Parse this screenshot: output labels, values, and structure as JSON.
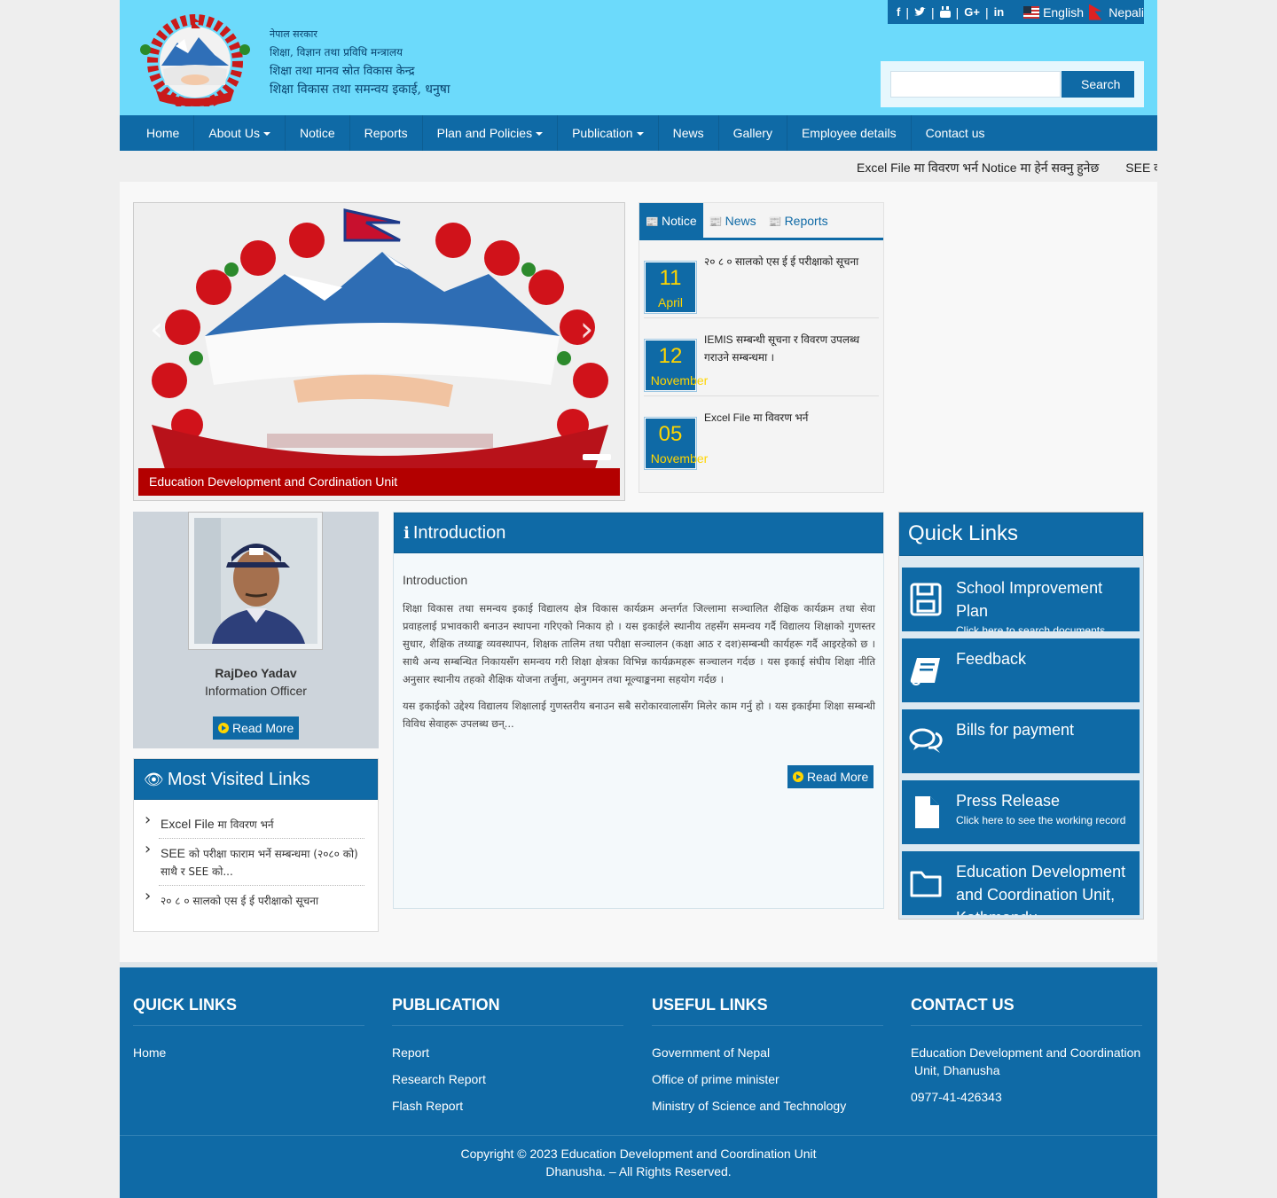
{
  "header": {
    "office_lines": [
      "नेपाल सरकार",
      "शिक्षा, विज्ञान तथा प्रविधि मन्त्रालय",
      "शिक्षा तथा मानव स्रोत विकास केन्द्र",
      "शिक्षा विकास तथा समन्वय इकाई, धनुषा"
    ],
    "social_icons": [
      "facebook-icon",
      "twitter-icon",
      "youtube-icon",
      "google-plus-icon",
      "linkedin-icon"
    ],
    "lang_english": "English",
    "lang_nepali": "Nepali",
    "search": {
      "placeholder": "",
      "button": "Search"
    }
  },
  "nav": [
    {
      "label": "Home",
      "dropdown": false
    },
    {
      "label": "About Us",
      "dropdown": true
    },
    {
      "label": "Notice",
      "dropdown": false
    },
    {
      "label": "Reports",
      "dropdown": false
    },
    {
      "label": "Plan and Policies",
      "dropdown": true
    },
    {
      "label": "Publication",
      "dropdown": true
    },
    {
      "label": "News",
      "dropdown": false
    },
    {
      "label": "Gallery",
      "dropdown": false
    },
    {
      "label": "Employee details",
      "dropdown": false
    },
    {
      "label": "Contact us",
      "dropdown": false
    }
  ],
  "ticker": [
    "Excel File मा विवरण भर्न Notice मा हेर्न सक्नु हुनेछ",
    "SEE को"
  ],
  "slider": {
    "caption": "Education Development and Cordination Unit"
  },
  "tabs": [
    "Notice",
    "News",
    "Reports"
  ],
  "notices": [
    {
      "day": "11",
      "month": "April",
      "text": "२० ८ ० सालको एस ई ई परीक्षाको सूचना"
    },
    {
      "day": "12",
      "month": "November",
      "text": "IEMIS सम्बन्धी सूचना र विवरण उपलब्ध गराउने सम्बन्धमा ।"
    },
    {
      "day": "05",
      "month": "November",
      "text": "Excel File मा विवरण भर्न"
    }
  ],
  "officer": {
    "name": "RajDeo Yadav",
    "title": "Information Officer",
    "read_more": "Read More"
  },
  "most_visited": {
    "title": "Most Visited Links",
    "links": [
      {
        "prefix": "Excel File",
        "rest": " मा विवरण भर्न"
      },
      {
        "prefix": "SEE",
        "rest": " को परीक्षा फाराम भर्ने सम्बन्धमा (२०८० को) साथै र SEE को..."
      },
      {
        "prefix": "",
        "rest": "२० ८ ० सालको एस ई ई परीक्षाको सूचना"
      }
    ]
  },
  "intro": {
    "title": "Introduction",
    "subtitle": "Introduction",
    "para1": "शिक्षा विकास तथा समन्वय इकाई विद्यालय क्षेत्र विकास कार्यक्रम अन्तर्गत जिल्लामा सञ्चालित शैक्षिक कार्यक्रम तथा सेवा प्रवाहलाई प्रभावकारी बनाउन स्थापना गरिएको निकाय हो । यस इकाईले स्थानीय तहसँग समन्वय गर्दै विद्यालय शिक्षाको गुणस्तर सुधार, शैक्षिक तथ्याङ्क व्यवस्थापन, शिक्षक तालिम तथा परीक्षा सञ्चालन (कक्षा आठ र दश)सम्बन्धी कार्यहरू गर्दै आइरहेको छ । साथै अन्य सम्बन्धित निकायसँग समन्वय गरी शिक्षा क्षेत्रका विभिन्न कार्यक्रमहरू सञ्चालन गर्दछ । यस इकाई संघीय शिक्षा नीति अनुसार स्थानीय तहको शैक्षिक योजना तर्जुमा, अनुगमन तथा मूल्याङ्कनमा सहयोग गर्दछ ।",
    "para2": "यस इकाईको उद्देश्य विद्यालय शिक्षालाई गुणस्तरीय बनाउन सबै सरोकारवालासँग मिलेर काम गर्नु हो । यस इकाईमा शिक्षा सम्बन्धी विविध सेवाहरू उपलब्ध छन्...",
    "read_more": "Read More"
  },
  "quick_links": {
    "title": "Quick Links",
    "items": [
      {
        "title": "School Improvement Plan",
        "sub": "Click here to search documents",
        "icon": "save-icon"
      },
      {
        "title": "Feedback",
        "sub": "",
        "icon": "book-icon"
      },
      {
        "title": "Bills for payment",
        "sub": "",
        "icon": "comments-icon"
      },
      {
        "title": "Press Release",
        "sub": "Click here to see the working record",
        "icon": "file-icon"
      },
      {
        "title": "Education Development and Coordination Unit, Kathmandu",
        "sub": "",
        "icon": "folder-icon"
      }
    ]
  },
  "footer": {
    "quick_links": {
      "title": "QUICK LINKS",
      "links": [
        "Home"
      ]
    },
    "publication": {
      "title": "PUBLICATION",
      "links": [
        "Report",
        "Research Report",
        "Flash Report"
      ]
    },
    "useful_links": {
      "title": "USEFUL LINKS",
      "links": [
        "Government of Nepal",
        "Office of prime minister",
        "Ministry of Science and Technology"
      ]
    },
    "contact": {
      "title": "CONTACT US",
      "address": "Education Development and Coordination Unit, Dhanusha",
      "phone": "0977-41-426343"
    },
    "copyright_line1": "Copyright © 2023 Education Development and Coordination Unit",
    "copyright_line2": "Dhanusha. – All Rights Reserved."
  },
  "colors": {
    "brand_blue": "#0f6aa6",
    "header_cyan": "#6cdafb",
    "accent_yellow": "#ffd500",
    "caption_red": "#b30000"
  }
}
